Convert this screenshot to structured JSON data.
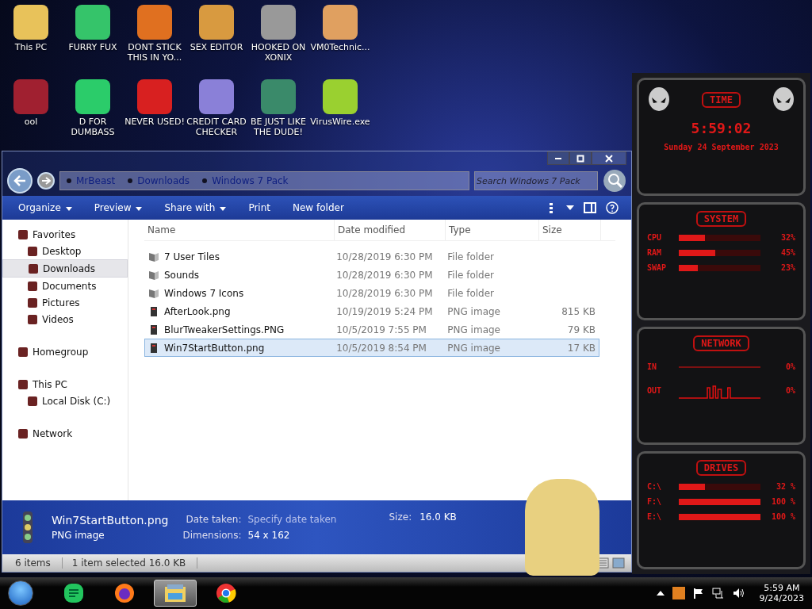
{
  "desktop_icons": [
    {
      "label": "This PC"
    },
    {
      "label": "FURRY FUX"
    },
    {
      "label": "DONT STICK THIS IN YO..."
    },
    {
      "label": "SEX EDITOR"
    },
    {
      "label": "HOOKED ON XONIX"
    },
    {
      "label": "VM0Technic..."
    },
    {
      "label": "ool"
    },
    {
      "label": "D FOR DUMBASS"
    },
    {
      "label": "NEVER USED!"
    },
    {
      "label": "CREDIT CARD CHECKER"
    },
    {
      "label": "BE JUST LIKE THE DUDE!"
    },
    {
      "label": "VirusWire.exe"
    }
  ],
  "explorer": {
    "breadcrumbs": [
      "MrBeast",
      "Downloads",
      "Windows 7 Pack"
    ],
    "search": {
      "placeholder": "Search Windows 7 Pack"
    },
    "toolbar": [
      {
        "label": "Organize",
        "dropdown": true
      },
      {
        "label": "Preview",
        "dropdown": true
      },
      {
        "label": "Share with",
        "dropdown": true
      },
      {
        "label": "Print",
        "dropdown": false
      },
      {
        "label": "New folder",
        "dropdown": false
      }
    ],
    "navigation": [
      {
        "label": "Favorites",
        "selected": false,
        "children": [
          {
            "label": "Desktop",
            "selected": false
          },
          {
            "label": "Downloads",
            "selected": true
          },
          {
            "label": "Documents",
            "selected": false
          },
          {
            "label": "Pictures",
            "selected": false
          },
          {
            "label": "Videos",
            "selected": false
          }
        ]
      },
      {
        "label": "Homegroup",
        "selected": false
      },
      {
        "label": "This PC",
        "selected": false,
        "children": [
          {
            "label": "Local Disk (C:)",
            "selected": false
          }
        ]
      },
      {
        "label": "Network",
        "selected": false
      }
    ],
    "columns": [
      "Name",
      "Date modified",
      "Type",
      "Size"
    ],
    "files": [
      {
        "kind": "folder",
        "name": "7 User Tiles",
        "date": "10/28/2019 6:30 PM",
        "type": "File folder",
        "selected": false
      },
      {
        "kind": "folder",
        "name": "Sounds",
        "date": "10/28/2019 6:30 PM",
        "type": "File folder",
        "selected": false
      },
      {
        "kind": "folder",
        "name": "Windows 7 Icons",
        "date": "10/28/2019 6:30 PM",
        "type": "File folder",
        "selected": false
      },
      {
        "kind": "image",
        "name": "AfterLook.png",
        "date": "10/19/2019 5:24 PM",
        "type": "PNG image",
        "size": "815 KB",
        "selected": false
      },
      {
        "kind": "image",
        "name": "BlurTweakerSettings.PNG",
        "date": "10/5/2019 7:55 PM",
        "type": "PNG image",
        "size": "79 KB",
        "selected": false
      },
      {
        "kind": "image",
        "name": "Win7StartButton.png",
        "date": "10/5/2019 8:54 PM",
        "type": "PNG image",
        "size": "17 KB",
        "selected": true
      }
    ],
    "details": {
      "name": "Win7StartButton.png",
      "type": "PNG image",
      "date_label": "Date taken:",
      "date_placeholder": "Specify date taken",
      "dimensions_label": "Dimensions:",
      "dimensions": "54 x 162",
      "size_label": "Size:",
      "size": "16.0 KB"
    },
    "status_bar": [
      "6 items",
      "1 item selected  16.0 KB"
    ]
  },
  "widget": {
    "time": {
      "title": "TIME",
      "clock": "5:59:02",
      "date": "Sunday 24 September 2023"
    },
    "system": {
      "title": "SYSTEM",
      "rows": [
        {
          "label": "CPU",
          "level": 0.32,
          "reading": "32%"
        },
        {
          "label": "RAM",
          "level": 0.45,
          "reading": "45%"
        },
        {
          "label": "SWAP",
          "level": 0.23,
          "reading": "23%"
        }
      ]
    },
    "network": {
      "title": "NETWORK",
      "rows": [
        {
          "label": "IN",
          "reading": "0%"
        },
        {
          "label": "OUT",
          "reading": "0%"
        }
      ]
    },
    "drives": {
      "title": "DRIVES",
      "rows": [
        {
          "label": "C:\\",
          "level": 0.32,
          "reading": "32 %"
        },
        {
          "label": "F:\\",
          "level": 1,
          "reading": "100 %"
        },
        {
          "label": "E:\\",
          "level": 1,
          "reading": "100 %"
        }
      ]
    }
  },
  "taskbar": {
    "apps": [
      {
        "kind": "notes",
        "selected": false
      },
      {
        "kind": "firefox",
        "selected": false
      },
      {
        "kind": "explorer",
        "selected": true
      },
      {
        "kind": "chrome",
        "selected": false
      }
    ],
    "time": "5:59 AM",
    "date": "9/24/2023"
  }
}
